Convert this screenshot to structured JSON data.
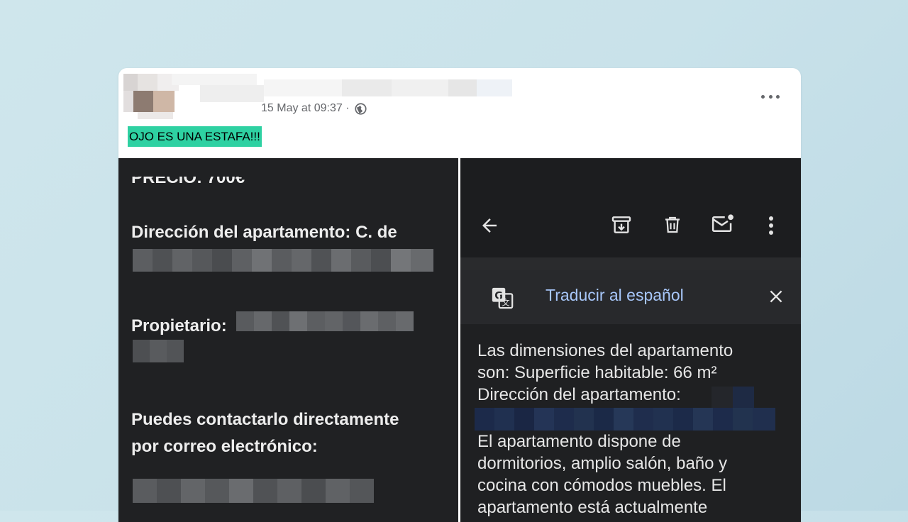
{
  "post": {
    "timestamp": "15 May at 09:37 ·",
    "privacy_icon": "globe-icon",
    "menu_icon": "more-icon",
    "text": "OJO ES UNA ESTAFA!!!",
    "highlight_color": "#2ed1a2"
  },
  "left_screenshot": {
    "address_label": "Dirección del apartamento: C. de",
    "owner_label": "Propietario:",
    "contact_line1": "Puedes contactarlo directamente",
    "contact_line2": "por correo electrónico:"
  },
  "right_screenshot": {
    "toolbar_icons": [
      "back-arrow-icon",
      "archive-icon",
      "delete-icon",
      "mark-unread-icon",
      "more-vert-icon"
    ],
    "translate_label": "Traducir al español",
    "lines": [
      "Las dimensiones del apartamento",
      "son: Superficie habitable: 66 m²",
      "Dirección del apartamento:",
      "El apartamento dispone de",
      "dormitorios, amplio salón, baño y",
      "cocina con cómodos muebles. El",
      "apartamento está actualmente"
    ]
  }
}
